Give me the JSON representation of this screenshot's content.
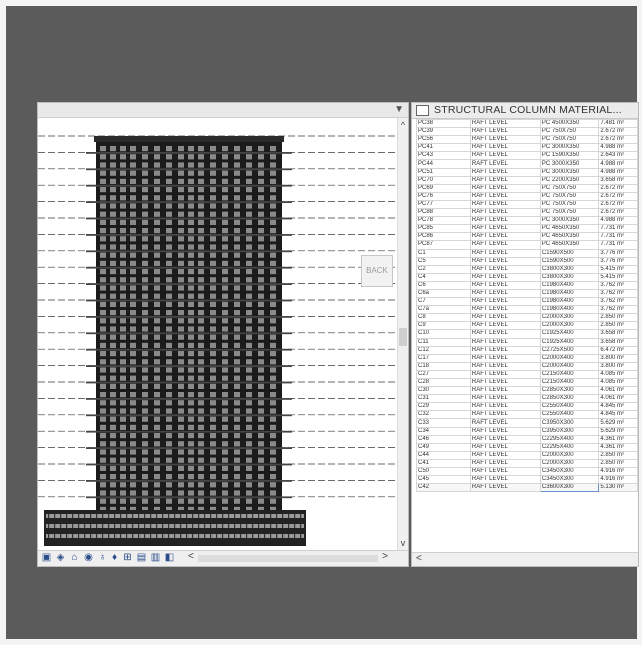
{
  "view": {
    "back_label": "BACK",
    "scroll_up": "^",
    "scroll_down": "v",
    "scroll_left": "<",
    "scroll_right": ">",
    "dropdown": "▼",
    "toolbar_icons": [
      "view-cube-icon",
      "3d-view-icon",
      "house-icon",
      "camera-icon",
      "lightbulb-icon",
      "locator-icon",
      "crop-icon",
      "printer-icon",
      "window-icon",
      "more-left-icon"
    ]
  },
  "schedule": {
    "title": "STRUCTURAL COLUMN MATERIAL...",
    "scroll_left": "<",
    "rows": [
      [
        "PC38",
        "RAFT LEVEL",
        "PC 4500X350",
        "7.481 m²"
      ],
      [
        "PC39",
        "RAFT LEVEL",
        "PC 750X750",
        "2.672 m²"
      ],
      [
        "PC56",
        "RAFT LEVEL",
        "PC 750X750",
        "2.672 m²"
      ],
      [
        "PC41",
        "RAFT LEVEL",
        "PC 3000X350",
        "4.988 m²"
      ],
      [
        "PC43",
        "RAFT LEVEL",
        "PC 1590X350",
        "2.643 m²"
      ],
      [
        "PC44",
        "RAFT LEVEL",
        "PC 3000X350",
        "4.988 m²"
      ],
      [
        "PC51",
        "RAFT LEVEL",
        "PC 3000X350",
        "4.988 m²"
      ],
      [
        "PC70",
        "RAFT LEVEL",
        "PC 2200X350",
        "3.658 m²"
      ],
      [
        "PC69",
        "RAFT LEVEL",
        "PC 750X750",
        "2.672 m²"
      ],
      [
        "PC76",
        "RAFT LEVEL",
        "PC 750X750",
        "2.672 m²"
      ],
      [
        "PC77",
        "RAFT LEVEL",
        "PC 750X750",
        "2.672 m²"
      ],
      [
        "PC88",
        "RAFT LEVEL",
        "PC 750X750",
        "2.672 m²"
      ],
      [
        "PC78",
        "RAFT LEVEL",
        "PC 3000X350",
        "4.988 m²"
      ],
      [
        "PC85",
        "RAFT LEVEL",
        "PC 4650X350",
        "7.731 m²"
      ],
      [
        "PC86",
        "RAFT LEVEL",
        "PC 4650X350",
        "7.731 m²"
      ],
      [
        "PC87",
        "RAFT LEVEL",
        "PC 4650X350",
        "7.731 m²"
      ],
      [
        "C1",
        "RAFT LEVEL",
        "C1590X500",
        "3.776 m²"
      ],
      [
        "C5",
        "RAFT LEVEL",
        "C1590X500",
        "3.776 m²"
      ],
      [
        "C2",
        "RAFT LEVEL",
        "C3800X300",
        "5.415 m²"
      ],
      [
        "C4",
        "RAFT LEVEL",
        "C3800X300",
        "5.415 m²"
      ],
      [
        "C6",
        "RAFT LEVEL",
        "C1980X400",
        "3.762 m²"
      ],
      [
        "C6a",
        "RAFT LEVEL",
        "C1980X400",
        "3.762 m²"
      ],
      [
        "C7",
        "RAFT LEVEL",
        "C1980X400",
        "3.762 m²"
      ],
      [
        "C7a",
        "RAFT LEVEL",
        "C1980X400",
        "3.762 m²"
      ],
      [
        "C8",
        "RAFT LEVEL",
        "C2000X300",
        "2.850 m²"
      ],
      [
        "C9",
        "RAFT LEVEL",
        "C2000X300",
        "2.850 m²"
      ],
      [
        "C10",
        "RAFT LEVEL",
        "C1925X400",
        "3.658 m²"
      ],
      [
        "C11",
        "RAFT LEVEL",
        "C1925X400",
        "3.658 m²"
      ],
      [
        "C12",
        "RAFT LEVEL",
        "C2725X500",
        "6.472 m²"
      ],
      [
        "C17",
        "RAFT LEVEL",
        "C2000X400",
        "3.800 m²"
      ],
      [
        "C18",
        "RAFT LEVEL",
        "C2000X400",
        "3.800 m²"
      ],
      [
        "C27",
        "RAFT LEVEL",
        "C2150X400",
        "4.085 m²"
      ],
      [
        "C28",
        "RAFT LEVEL",
        "C2150X400",
        "4.085 m²"
      ],
      [
        "C30",
        "RAFT LEVEL",
        "C2850X300",
        "4.061 m²"
      ],
      [
        "C31",
        "RAFT LEVEL",
        "C2850X300",
        "4.061 m²"
      ],
      [
        "C29",
        "RAFT LEVEL",
        "C2550X400",
        "4.845 m²"
      ],
      [
        "C32",
        "RAFT LEVEL",
        "C2550X400",
        "4.845 m²"
      ],
      [
        "C33",
        "RAFT LEVEL",
        "C3950X300",
        "5.629 m²"
      ],
      [
        "C34",
        "RAFT LEVEL",
        "C3950X300",
        "5.629 m²"
      ],
      [
        "C46",
        "RAFT LEVEL",
        "C2295X400",
        "4.361 m²"
      ],
      [
        "C49",
        "RAFT LEVEL",
        "C2295X400",
        "4.361 m²"
      ],
      [
        "C44",
        "RAFT LEVEL",
        "C2000X300",
        "2.850 m²"
      ],
      [
        "C41",
        "RAFT LEVEL",
        "C2000X300",
        "2.850 m²"
      ],
      [
        "C50",
        "RAFT LEVEL",
        "C3450X300",
        "4.916 m²"
      ],
      [
        "C45",
        "RAFT LEVEL",
        "C3450X300",
        "4.916 m²"
      ],
      [
        "C42",
        "RAFT LEVEL",
        "C3600X300",
        "5.130 m²"
      ]
    ]
  }
}
